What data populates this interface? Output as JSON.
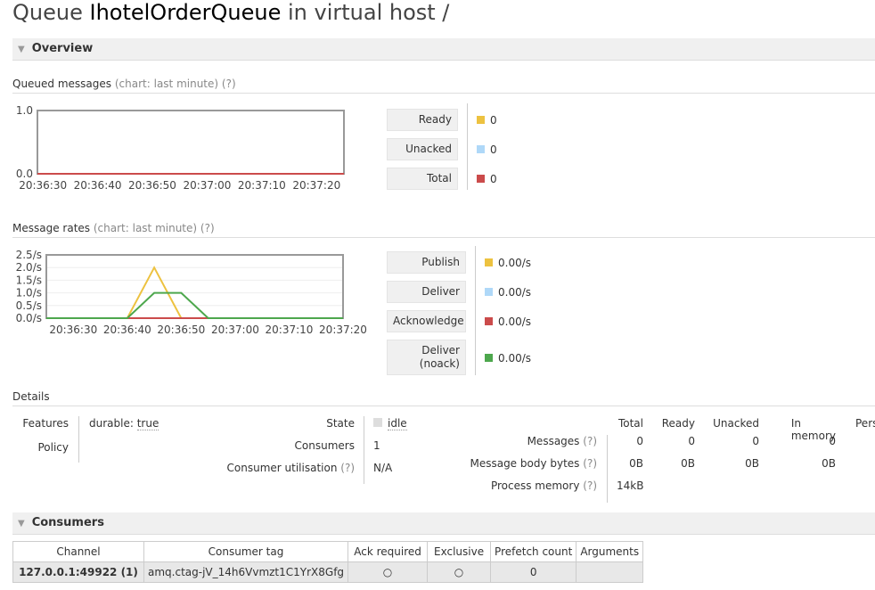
{
  "title": {
    "prefix": "Queue",
    "name": "IhotelOrderQueue",
    "suffix": "in virtual host /"
  },
  "overview": {
    "label": "Overview",
    "queued": {
      "title": "Queued messages",
      "chart_note": "(chart: last minute)",
      "help": "(?)",
      "legend": [
        {
          "label": "Ready",
          "value": "0",
          "color": "#edc240"
        },
        {
          "label": "Unacked",
          "value": "0",
          "color": "#afd8f8"
        },
        {
          "label": "Total",
          "value": "0",
          "color": "#cb4b4b"
        }
      ]
    },
    "rates": {
      "title": "Message rates",
      "chart_note": "(chart: last minute)",
      "help": "(?)",
      "legend": [
        {
          "label": "Publish",
          "value": "0.00/s",
          "color": "#edc240"
        },
        {
          "label": "Deliver",
          "value": "0.00/s",
          "color": "#afd8f8"
        },
        {
          "label": "Acknowledge",
          "value": "0.00/s",
          "color": "#cb4b4b"
        },
        {
          "label": "Deliver\n(noack)",
          "value": "0.00/s",
          "color": "#4da74d"
        }
      ]
    }
  },
  "chart_data": [
    {
      "type": "line",
      "x_ticks": [
        "20:36:30",
        "20:36:40",
        "20:36:50",
        "20:37:00",
        "20:37:10",
        "20:37:20"
      ],
      "y_ticks": [
        "0.0",
        "1.0"
      ],
      "xlim": [
        "20:36:29",
        "20:37:25"
      ],
      "ylim": [
        0,
        1
      ],
      "series": [
        {
          "name": "Total",
          "color": "#cb4b4b",
          "x": [
            "20:36:29",
            "20:37:25"
          ],
          "y": [
            0,
            0
          ]
        }
      ]
    },
    {
      "type": "line",
      "x_ticks": [
        "20:36:30",
        "20:36:40",
        "20:36:50",
        "20:37:00",
        "20:37:10",
        "20:37:20"
      ],
      "y_ticks": [
        "0.0/s",
        "0.5/s",
        "1.0/s",
        "1.5/s",
        "2.0/s",
        "2.5/s"
      ],
      "xlim": [
        "20:36:25",
        "20:37:20"
      ],
      "ylim": [
        0,
        2.5
      ],
      "grid": true,
      "series": [
        {
          "name": "Publish",
          "color": "#edc240",
          "x": [
            "20:36:25",
            "20:36:40",
            "20:36:45",
            "20:36:50"
          ],
          "y": [
            0,
            0,
            2,
            0
          ]
        },
        {
          "name": "Acknowledge",
          "color": "#cb4b4b",
          "x": [
            "20:36:40",
            "20:36:55"
          ],
          "y": [
            0,
            0
          ]
        },
        {
          "name": "Deliver (noack)",
          "color": "#4da74d",
          "x": [
            "20:36:25",
            "20:36:40",
            "20:36:45",
            "20:36:50",
            "20:36:55",
            "20:37:20"
          ],
          "y": [
            0,
            0,
            1,
            1,
            0,
            0
          ]
        }
      ]
    }
  ],
  "details": {
    "label": "Details",
    "features_label": "Features",
    "features_key": "durable:",
    "features_value": "true",
    "policy_label": "Policy",
    "state_label": "State",
    "state_value": "idle",
    "consumers_label": "Consumers",
    "consumers_value": "1",
    "util_label": "Consumer utilisation",
    "util_value": "N/A",
    "help": "(?)",
    "stats_headers": [
      "Total",
      "Ready",
      "Unacked",
      "In memory",
      "Pers"
    ],
    "stats_rows": [
      {
        "label": "Messages",
        "values": [
          "0",
          "0",
          "0",
          "0"
        ]
      },
      {
        "label": "Message body bytes",
        "values": [
          "0B",
          "0B",
          "0B",
          "0B"
        ]
      },
      {
        "label": "Process memory",
        "values": [
          "14kB"
        ]
      }
    ]
  },
  "consumers": {
    "label": "Consumers",
    "headers": [
      "Channel",
      "Consumer tag",
      "Ack required",
      "Exclusive",
      "Prefetch count",
      "Arguments"
    ],
    "rows": [
      {
        "channel": "127.0.0.1:49922 (1)",
        "tag": "amq.ctag-jV_14h6Vvmzt1C1YrX8Gfg",
        "ack": "○",
        "exclusive": "○",
        "prefetch": "0",
        "arguments": ""
      }
    ]
  }
}
